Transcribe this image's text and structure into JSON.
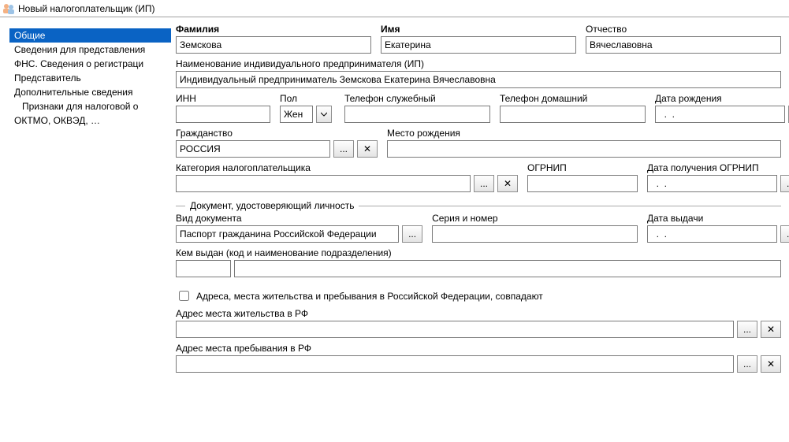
{
  "window": {
    "title": "Новый налогоплательщик (ИП)"
  },
  "sidebar": {
    "items": [
      {
        "label": "Общие",
        "selected": true
      },
      {
        "label": "Сведения для представления"
      },
      {
        "label": "ФНС. Сведения о регистраци"
      },
      {
        "label": "Представитель"
      },
      {
        "label": "Дополнительные сведения"
      },
      {
        "label": "Признаки для налоговой о",
        "sub": true
      },
      {
        "label": "ОКТМО, ОКВЭД, …"
      }
    ]
  },
  "labels": {
    "familia": "Фамилия",
    "imya": "Имя",
    "otchestvo": "Отчество",
    "fullname": "Наименование индивидуального предпринимателя (ИП)",
    "inn": "ИНН",
    "pol": "Пол",
    "tel_sluzh": "Телефон служебный",
    "tel_dom": "Телефон домашний",
    "dob": "Дата рождения",
    "grazhdanstvo": "Гражданство",
    "mesto_rozhd": "Место рождения",
    "kategoria": "Категория налогоплательщика",
    "ogrnip": "ОГРНИП",
    "data_ogrnip": "Дата получения ОГРНИП",
    "doc_group": "Документ, удостоверяющий личность",
    "vid_doc": "Вид документа",
    "seria": "Серия и номер",
    "data_vydachi": "Дата выдачи",
    "kem_vydan": "Кем выдан (код и наименование подразделения)",
    "addr_chk": "Адреса, места жительства и пребывания в Российской Федерации, совпадают",
    "addr_zhit": "Адрес места жительства в РФ",
    "addr_preb": "Адрес места пребывания в РФ"
  },
  "values": {
    "familia": "Земскова",
    "imya": "Екатерина",
    "otchestvo": "Вячеславовна",
    "fullname": "Индивидуальный предприниматель Земскова Екатерина Вячеславовна",
    "inn": "",
    "pol": "Жен",
    "tel_sluzh": "",
    "tel_dom": "",
    "dob": "  .  .    ",
    "grazhdanstvo": "РОССИЯ",
    "mesto_rozhd": "",
    "kategoria": "",
    "ogrnip": "",
    "data_ogrnip": "  .  .    ",
    "vid_doc": "Паспорт гражданина Российской Федерации",
    "seria": "",
    "data_vydachi": "  .  .    ",
    "kem_code": "",
    "kem_text": "",
    "addr_zhit": "",
    "addr_preb": ""
  },
  "buttons": {
    "ellipsis": "...",
    "clear": "✕"
  }
}
